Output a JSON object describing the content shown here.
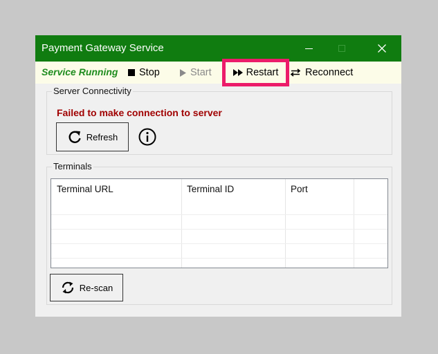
{
  "window": {
    "title": "Payment Gateway Service",
    "accent": "#107c10",
    "controls": [
      "minimize-icon",
      "maximize-icon",
      "close-icon"
    ]
  },
  "toolbar": {
    "status": "Service Running",
    "stop": "Stop",
    "start": "Start",
    "restart": "Restart",
    "reconnect": "Reconnect",
    "highlight_color": "#ec1c6a"
  },
  "server_group": {
    "label": "Server Connectivity",
    "error": "Failed to make connection to server",
    "refresh_label": "Refresh",
    "info_icon": "info-icon"
  },
  "terminals_group": {
    "label": "Terminals",
    "columns": [
      "Terminal URL",
      "Terminal ID",
      "Port"
    ],
    "rows": [],
    "rescan_label": "Re-scan"
  }
}
